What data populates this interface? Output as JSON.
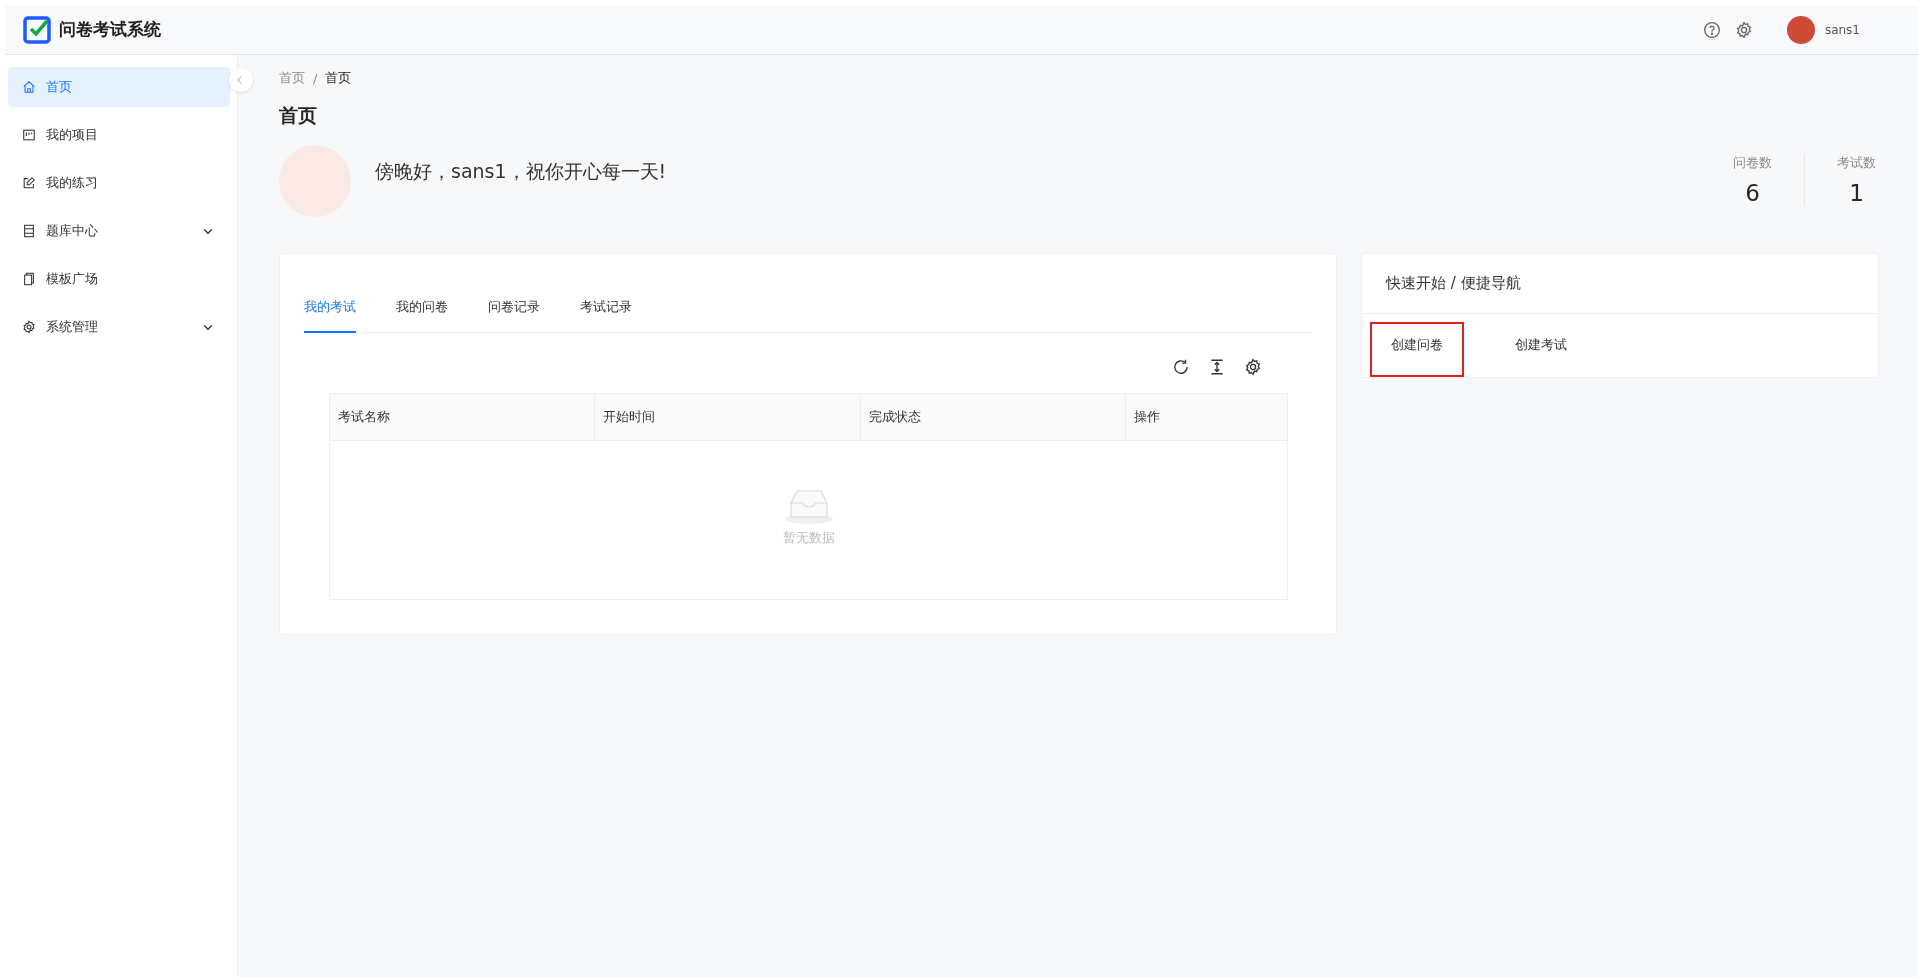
{
  "header": {
    "title": "问卷考试系统",
    "user": {
      "name": "sans1"
    }
  },
  "sidebar": {
    "items": [
      {
        "label": "首页",
        "kind": "link",
        "selected": true
      },
      {
        "label": "我的项目",
        "kind": "link",
        "selected": false
      },
      {
        "label": "我的练习",
        "kind": "link",
        "selected": false
      },
      {
        "label": "题库中心",
        "kind": "group",
        "selected": false,
        "expanded": false
      },
      {
        "label": "模板广场",
        "kind": "link",
        "selected": false
      },
      {
        "label": "系统管理",
        "kind": "group",
        "selected": false,
        "expanded": false
      }
    ]
  },
  "breadcrumb": {
    "items": [
      "首页",
      "首页"
    ],
    "separator": "/"
  },
  "page_title": "首页",
  "greeting": "傍晚好，sans1，祝你开心每一天!",
  "stats": [
    {
      "label": "问卷数",
      "value": "6"
    },
    {
      "label": "考试数",
      "value": "1"
    }
  ],
  "tabs": [
    {
      "label": "我的考试",
      "selected": true
    },
    {
      "label": "我的问卷",
      "selected": false
    },
    {
      "label": "问卷记录",
      "selected": false
    },
    {
      "label": "考试记录",
      "selected": false
    }
  ],
  "table": {
    "columns": [
      "考试名称",
      "开始时间",
      "完成状态",
      "操作"
    ],
    "empty_text": "暂无数据"
  },
  "quick": {
    "title": "快速开始 / 便捷导航",
    "actions": [
      {
        "label": "创建问卷",
        "highlighted": true
      },
      {
        "label": "创建考试",
        "highlighted": false
      }
    ]
  }
}
